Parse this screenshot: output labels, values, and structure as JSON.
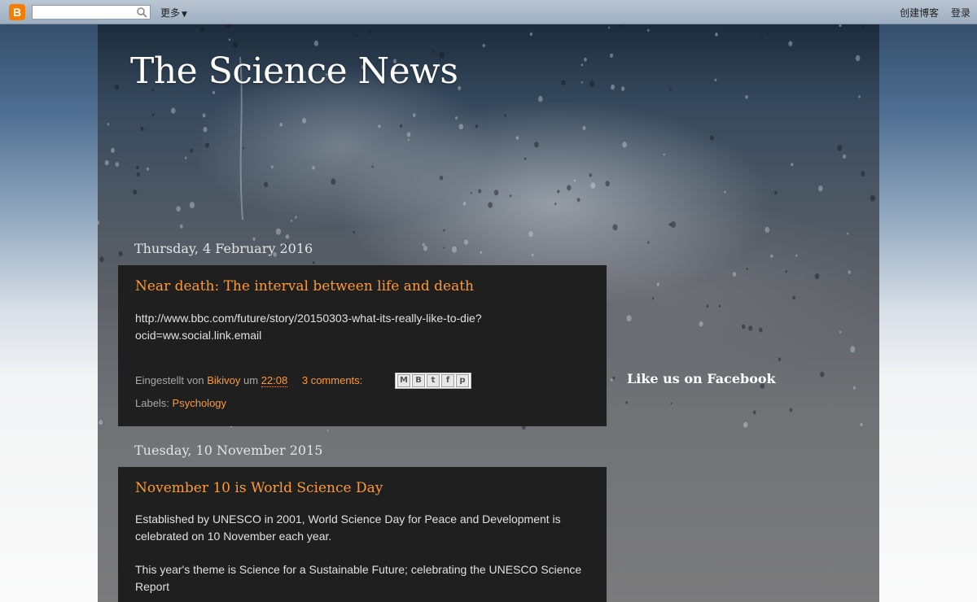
{
  "navbar": {
    "logo_letter": "B",
    "search_value": "",
    "more_label": "更多",
    "create_blog_label": "创建博客",
    "login_label": "登录"
  },
  "blog": {
    "title": "The Science News"
  },
  "posts": [
    {
      "date": "Thursday, 4 February 2016",
      "title": "Near death: The interval between life and death",
      "body": [
        "http://www.bbc.com/future/story/20150303-what-its-really-like-to-die?",
        "ocid=ww.social.link.email"
      ],
      "posted_by_prefix": "Eingestellt von",
      "author": "Bikivoy",
      "at_label": "um",
      "time": "22:08",
      "comments": "3 comments:",
      "labels_prefix": "Labels:",
      "label": "Psychology",
      "share_icons": [
        "email-icon",
        "blogger-icon",
        "twitter-icon",
        "facebook-icon",
        "pinterest-icon"
      ]
    },
    {
      "date": "Tuesday, 10 November 2015",
      "title": "November 10 is World Science Day",
      "paragraphs": [
        "Established by UNESCO in 2001, World Science Day for Peace and Development is celebrated on 10 November each year.",
        "This year's theme is Science for a Sustainable Future; celebrating the UNESCO Science Report"
      ]
    }
  ],
  "sidebar": {
    "facebook_title": "Like us on Facebook"
  },
  "colors": {
    "accent_link": "#ff9a32",
    "post_bg": "#1f1f1f",
    "blogger_orange": "#f57d00"
  }
}
